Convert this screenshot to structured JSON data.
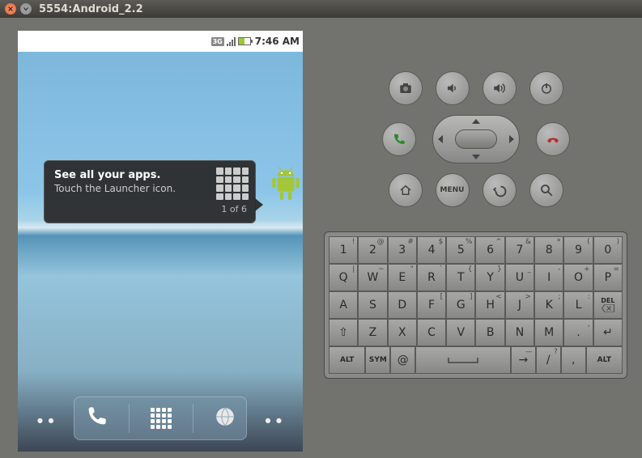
{
  "window": {
    "title": "5554:Android_2.2"
  },
  "statusbar": {
    "net": "3G",
    "time": "7:46 AM"
  },
  "tip": {
    "title": "See all your apps.",
    "subtitle": "Touch the Launcher icon.",
    "count": "1 of 6"
  },
  "dock": {
    "phone": "phone",
    "launcher": "launcher",
    "browser": "browser"
  },
  "hw": {
    "menu": "MENU"
  },
  "keyboard": {
    "rows": [
      [
        {
          "m": "1",
          "s": "!"
        },
        {
          "m": "2",
          "s": "@"
        },
        {
          "m": "3",
          "s": "#"
        },
        {
          "m": "4",
          "s": "$"
        },
        {
          "m": "5",
          "s": "%"
        },
        {
          "m": "6",
          "s": "^"
        },
        {
          "m": "7",
          "s": "&"
        },
        {
          "m": "8",
          "s": "*"
        },
        {
          "m": "9",
          "s": "("
        },
        {
          "m": "0",
          "s": ")"
        }
      ],
      [
        {
          "m": "Q",
          "s": "|"
        },
        {
          "m": "W",
          "s": "~"
        },
        {
          "m": "E",
          "s": "\""
        },
        {
          "m": "R",
          "s": "`"
        },
        {
          "m": "T",
          "s": "{"
        },
        {
          "m": "Y",
          "s": "}"
        },
        {
          "m": "U",
          "s": "_"
        },
        {
          "m": "I",
          "s": "-"
        },
        {
          "m": "O",
          "s": "+"
        },
        {
          "m": "P",
          "s": "="
        }
      ],
      [
        {
          "m": "A"
        },
        {
          "m": "S"
        },
        {
          "m": "D"
        },
        {
          "m": "F",
          "s": "["
        },
        {
          "m": "G",
          "s": "]"
        },
        {
          "m": "H",
          "s": "<"
        },
        {
          "m": "J",
          "s": ">"
        },
        {
          "m": "K",
          "s": ";"
        },
        {
          "m": "L",
          "s": ":"
        },
        {
          "m": "DEL",
          "del": true
        }
      ],
      [
        {
          "m": "⇧"
        },
        {
          "m": "Z"
        },
        {
          "m": "X"
        },
        {
          "m": "C"
        },
        {
          "m": "V"
        },
        {
          "m": "B"
        },
        {
          "m": "N"
        },
        {
          "m": "M"
        },
        {
          "m": ".",
          ",": true,
          "s": ","
        },
        {
          "m": "↵"
        }
      ],
      [
        {
          "m": "ALT",
          "small": true,
          "w": 1.5
        },
        {
          "m": "SYM",
          "small": true
        },
        {
          "m": "@"
        },
        {
          "m": "",
          "space": true,
          "w": 4
        },
        {
          "m": "→",
          "s": "—"
        },
        {
          "m": "/",
          "s": "?"
        },
        {
          "m": ",",
          ",": true
        },
        {
          "m": "ALT",
          "small": true,
          "w": 1.5
        }
      ]
    ]
  }
}
